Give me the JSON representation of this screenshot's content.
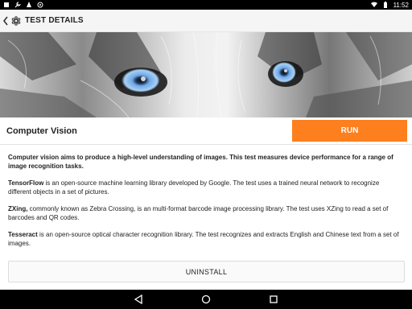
{
  "status_bar": {
    "time": "11:52",
    "left_icons": [
      "notification-icon",
      "wrench-icon",
      "sync-icon",
      "app-icon"
    ],
    "right_icons": [
      "wifi-icon",
      "battery-icon"
    ]
  },
  "app_bar": {
    "title": "TEST DETAILS"
  },
  "test": {
    "title": "Computer Vision",
    "run_label": "RUN"
  },
  "description": {
    "lead": "Computer vision aims to produce a high-level understanding of images. This test measures device performance for a range of image recognition tasks.",
    "items": [
      {
        "name": "TensorFlow",
        "text": " is an open-source machine learning library developed by Google. The test uses a trained neural network to recognize different objects in a set of pictures."
      },
      {
        "name": "ZXing,",
        "text": " commonly known as Zebra Crossing, is an multi-format barcode image processing library. The test uses XZing to read a set of barcodes and QR codes."
      },
      {
        "name": "Tesseract",
        "text": " is an open-source optical character recognition library. The test recognizes and extracts English and Chinese text from a set of images."
      }
    ]
  },
  "uninstall_label": "UNINSTALL",
  "colors": {
    "accent": "#fd7f1e",
    "eye": "#6fa8e6"
  }
}
